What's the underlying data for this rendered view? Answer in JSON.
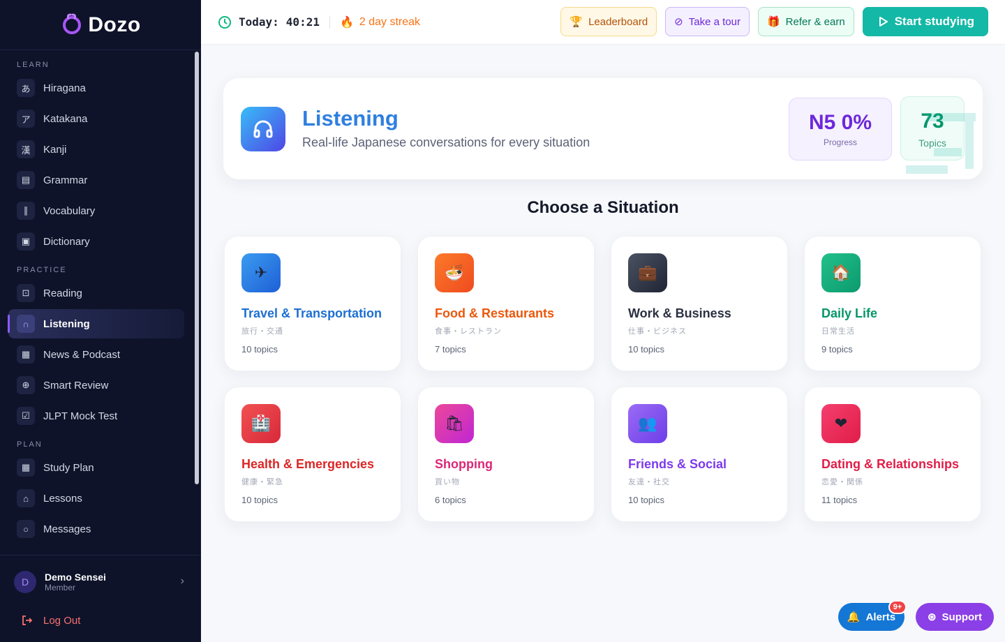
{
  "brand": {
    "name": "Dozo",
    "accent": "#a855f7"
  },
  "sidebar": {
    "sections": [
      {
        "title": "LEARN",
        "items": [
          {
            "label": "Hiragana",
            "icon": "あ"
          },
          {
            "label": "Katakana",
            "icon": "ア"
          },
          {
            "label": "Kanji",
            "icon": "漢"
          },
          {
            "label": "Grammar",
            "icon": "▤"
          },
          {
            "label": "Vocabulary",
            "icon": "∥"
          },
          {
            "label": "Dictionary",
            "icon": "▣"
          }
        ]
      },
      {
        "title": "PRACTICE",
        "items": [
          {
            "label": "Reading",
            "icon": "⊡"
          },
          {
            "label": "Listening",
            "icon": "∩",
            "active": true
          },
          {
            "label": "News & Podcast",
            "icon": "▦"
          },
          {
            "label": "Smart Review",
            "icon": "⊕"
          },
          {
            "label": "JLPT Mock Test",
            "icon": "☑"
          }
        ]
      },
      {
        "title": "PLAN",
        "items": [
          {
            "label": "Study Plan",
            "icon": "▦"
          },
          {
            "label": "Lessons",
            "icon": "⌂"
          },
          {
            "label": "Messages",
            "icon": "○"
          }
        ]
      }
    ],
    "user": {
      "initial": "D",
      "name": "Demo Sensei",
      "role": "Member"
    },
    "logout_label": "Log Out"
  },
  "topbar": {
    "today_label": "Today:",
    "today_time": "40:21",
    "streak": "2 day streak",
    "leaderboard": "Leaderboard",
    "tour": "Take a tour",
    "refer": "Refer & earn",
    "start": "Start studying"
  },
  "header": {
    "title": "Listening",
    "subtitle": "Real-life Japanese conversations for every situation",
    "level_value": "N5 0%",
    "level_label": "Progress",
    "topics_value": "73",
    "topics_label": "Topics"
  },
  "section_heading": "Choose a Situation",
  "situations": [
    {
      "title": "Travel & Transportation",
      "jp": "旅行・交通",
      "count": "10 topics",
      "color": "#1d6fd1",
      "icon_bg": "linear-gradient(135deg,#3b9cf0,#1e5fd6)",
      "icon": "✈"
    },
    {
      "title": "Food & Restaurants",
      "jp": "食事・レストラン",
      "count": "7 topics",
      "color": "#ea580c",
      "icon_bg": "linear-gradient(135deg,#fb7a2a,#ef4b1f)",
      "icon": "🍜"
    },
    {
      "title": "Work & Business",
      "jp": "仕事・ビジネス",
      "count": "10 topics",
      "color": "#2b3142",
      "icon_bg": "linear-gradient(135deg,#4b5363,#1f2433)",
      "icon": "💼"
    },
    {
      "title": "Daily Life",
      "jp": "日常生活",
      "count": "9 topics",
      "color": "#059669",
      "icon_bg": "linear-gradient(135deg,#22c08a,#0c9a6e)",
      "icon": "🏠"
    },
    {
      "title": "Health & Emergencies",
      "jp": "健康・緊急",
      "count": "10 topics",
      "color": "#dc2626",
      "icon_bg": "linear-gradient(135deg,#f05252,#d9283a)",
      "icon": "🏥"
    },
    {
      "title": "Shopping",
      "jp": "買い物",
      "count": "6 topics",
      "color": "#db2777",
      "icon_bg": "linear-gradient(135deg,#ec4899,#c026d3)",
      "icon": "🛍"
    },
    {
      "title": "Friends & Social",
      "jp": "友達・社交",
      "count": "10 topics",
      "color": "#7c3aed",
      "icon_bg": "linear-gradient(135deg,#9b6bf5,#6d3ee8)",
      "icon": "👥"
    },
    {
      "title": "Dating & Relationships",
      "jp": "恋愛・関係",
      "count": "11 topics",
      "color": "#e11d48",
      "icon_bg": "linear-gradient(135deg,#f43f6e,#e11d48)",
      "icon": "❤"
    }
  ],
  "fab": {
    "alerts": "Alerts",
    "badge": "9+",
    "support": "Support"
  }
}
